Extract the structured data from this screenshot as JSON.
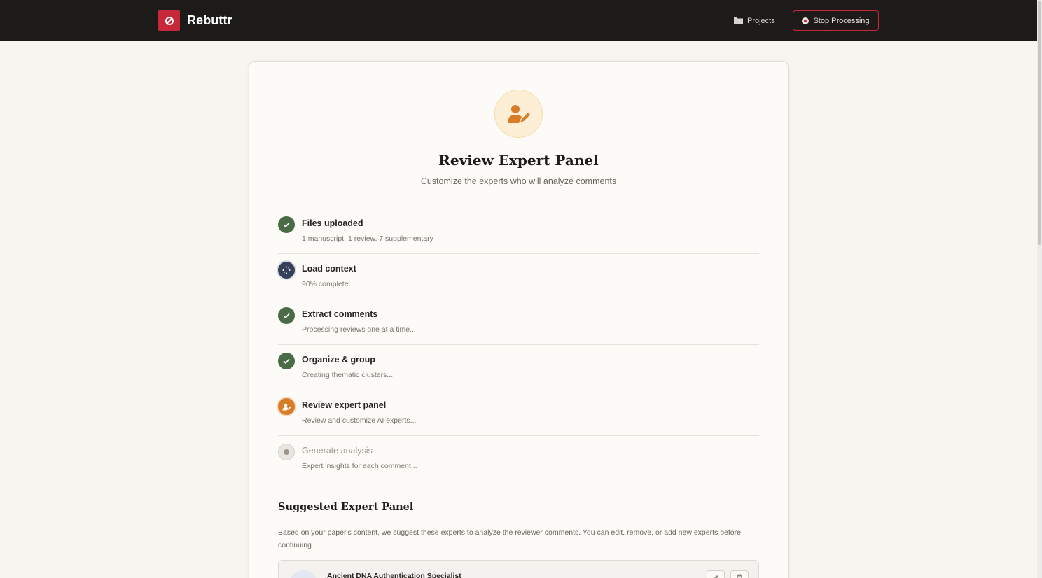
{
  "app": {
    "brand_name": "Rebuttr",
    "accent_color": "#c8293a"
  },
  "header": {
    "projects_label": "Projects",
    "stop_label": "Stop Processing"
  },
  "page": {
    "title": "Review Expert Panel",
    "subtitle": "Customize the experts who will analyze comments",
    "icon": "user-edit-icon"
  },
  "steps": [
    {
      "title": "Files uploaded",
      "subtitle": "1 manuscript, 1 review, 7 supplementary",
      "status": "done",
      "icon": "check-icon"
    },
    {
      "title": "Load context",
      "subtitle": "90% complete",
      "status": "in-progress",
      "icon": "spinner-icon"
    },
    {
      "title": "Extract comments",
      "subtitle": "Processing reviews one at a time...",
      "status": "done",
      "icon": "check-icon"
    },
    {
      "title": "Organize & group",
      "subtitle": "Creating thematic clusters...",
      "status": "done",
      "icon": "check-icon"
    },
    {
      "title": "Review expert panel",
      "subtitle": "Review and customize AI experts...",
      "status": "current",
      "icon": "user-edit-icon"
    },
    {
      "title": "Generate analysis",
      "subtitle": "Expert insights for each comment...",
      "status": "pending",
      "icon": "dot-icon"
    }
  ],
  "panel": {
    "title": "Suggested Expert Panel",
    "description": "Based on your paper's content, we suggest these experts to analyze the reviewer comments. You can edit, remove, or add new experts before continuing.",
    "experts": [
      {
        "name": "Ancient DNA Authentication Specialist"
      }
    ]
  },
  "colors": {
    "done": "#4b6b48",
    "in_progress": "#36405a",
    "current": "#d97c29",
    "pending": "#e9e6e1"
  }
}
